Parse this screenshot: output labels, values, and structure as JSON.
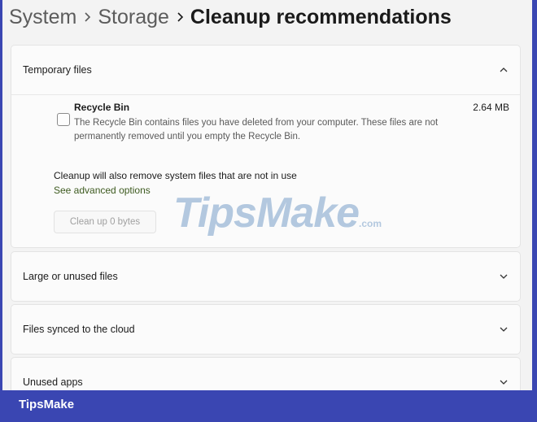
{
  "breadcrumb": {
    "items": [
      "System",
      "Storage"
    ],
    "current": "Cleanup recommendations"
  },
  "sections": [
    {
      "label": "Temporary files",
      "expanded": true
    },
    {
      "label": "Large or unused files",
      "expanded": false
    },
    {
      "label": "Files synced to the cloud",
      "expanded": false
    },
    {
      "label": "Unused apps",
      "expanded": false
    }
  ],
  "temporary": {
    "item": {
      "title": "Recycle Bin",
      "size": "2.64 MB",
      "description": "The Recycle Bin contains files you have deleted from your computer. These files are not permanently removed until you empty the Recycle Bin.",
      "checked": false
    },
    "note": "Cleanup will also remove system files that are not in use",
    "link": "See advanced options",
    "button": "Clean up 0 bytes"
  },
  "watermark": {
    "brand": "TipsMake",
    "suffix": ".com"
  },
  "footer": {
    "brand": "TipsMake"
  },
  "colors": {
    "frame": "#3a46b2",
    "link": "#3d5a1f",
    "watermark": "#9bb8d6"
  }
}
